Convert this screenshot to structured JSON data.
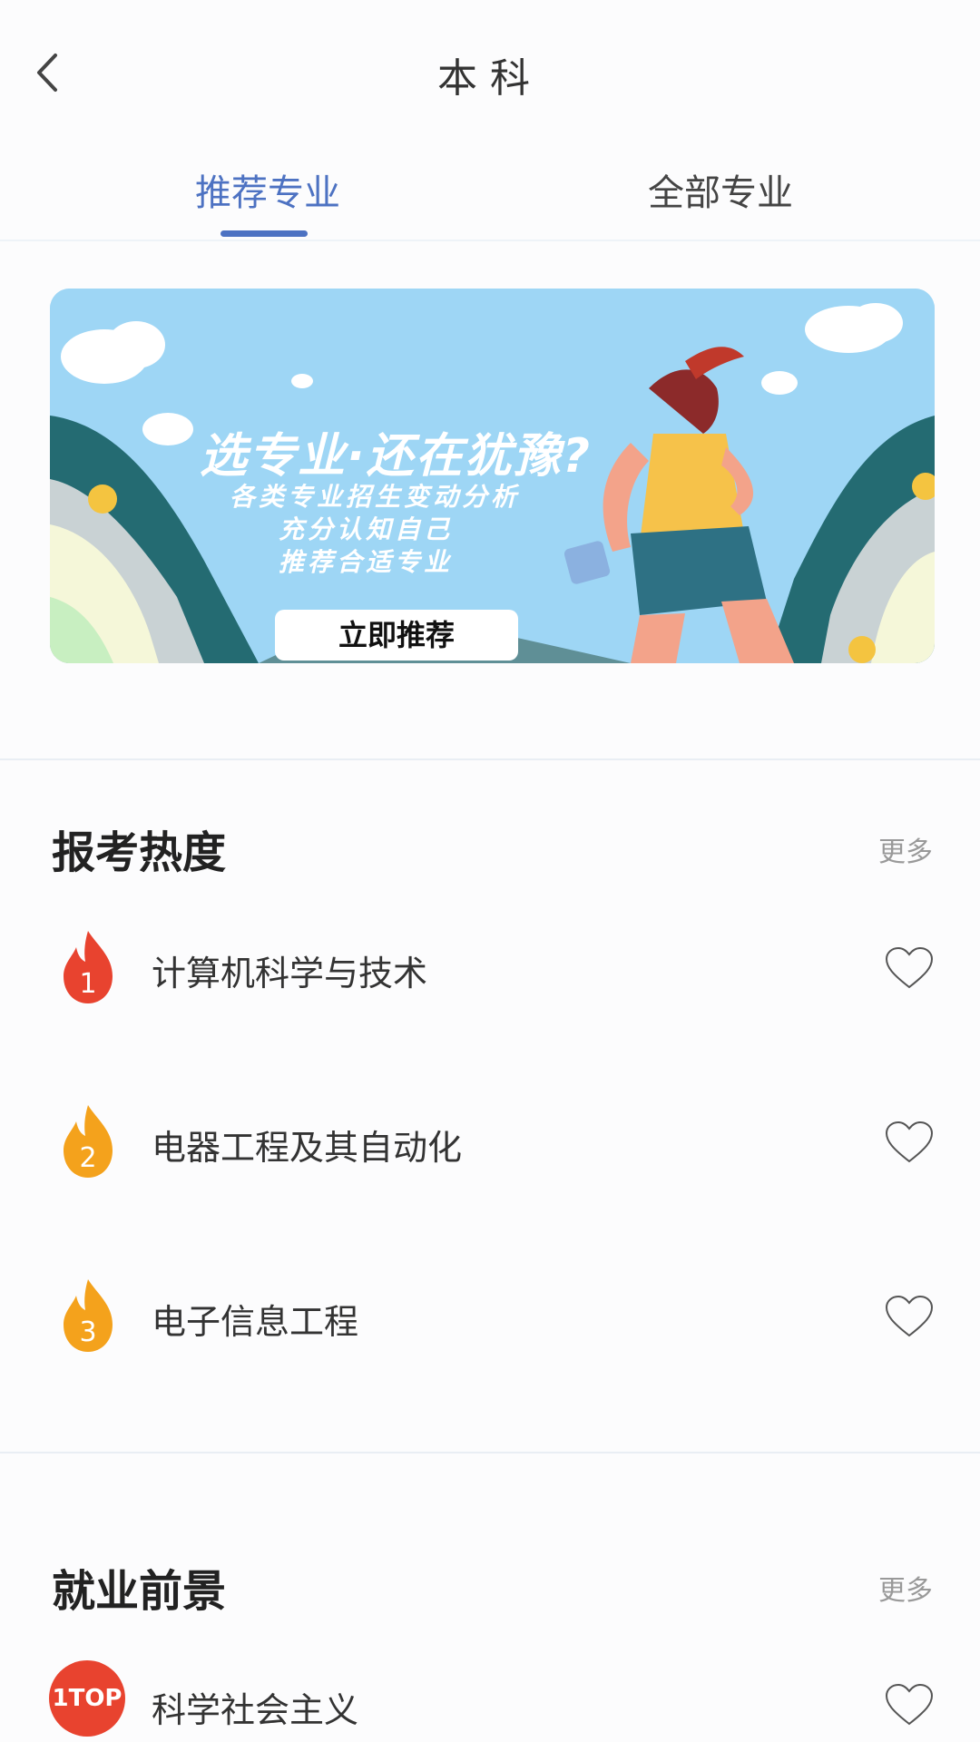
{
  "header": {
    "title": "本科"
  },
  "tabs": [
    {
      "label": "推荐专业",
      "active": true
    },
    {
      "label": "全部专业",
      "active": false
    }
  ],
  "banner": {
    "title": "选专业·还在犹豫?",
    "lines": [
      "各类专业招生变动分析",
      "充分认知自己",
      "推荐合适专业"
    ],
    "cta": "立即推荐"
  },
  "hot_section": {
    "title": "报考热度",
    "more": "更多",
    "items": [
      {
        "rank": "1",
        "name": "计算机科学与技术",
        "icon": "flame-rank-1-icon",
        "color": "#e8432f"
      },
      {
        "rank": "2",
        "name": "电器工程及其自动化",
        "icon": "flame-rank-2-icon",
        "color": "#f4a21c"
      },
      {
        "rank": "3",
        "name": "电子信息工程",
        "icon": "flame-rank-3-icon",
        "color": "#f4a21c"
      }
    ]
  },
  "job_section": {
    "title": "就业前景",
    "more": "更多",
    "items": [
      {
        "badge": "1TOP",
        "name": "科学社会主义"
      }
    ]
  },
  "colors": {
    "accent": "#4d72c2",
    "flame_red": "#e8432f",
    "flame_orange": "#f4a21c"
  }
}
